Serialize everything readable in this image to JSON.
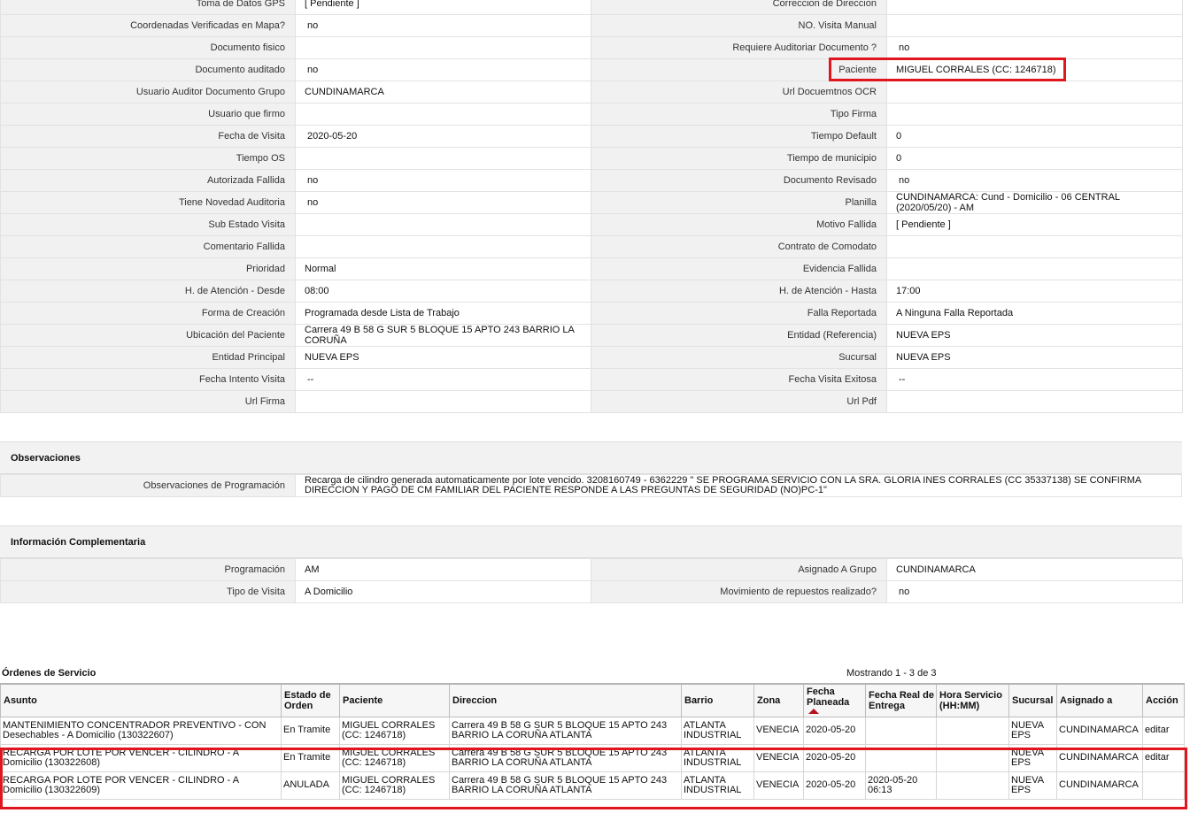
{
  "fields": [
    [
      "Toma de Datos GPS",
      "[ Pendiente ]",
      "Correccion de Direccion",
      ""
    ],
    [
      "Coordenadas Verificadas en Mapa?",
      "no",
      "NO. Visita Manual",
      ""
    ],
    [
      "Documento fisico",
      "",
      "Requiere Auditoriar Documento ?",
      "no"
    ],
    [
      "Documento auditado",
      "no",
      "Paciente",
      "MIGUEL CORRALES (CC: 1246718)"
    ],
    [
      "Usuario Auditor Documento Grupo",
      "CUNDINAMARCA",
      "Url Docuemtnos OCR",
      ""
    ],
    [
      "Usuario que firmo",
      "",
      "Tipo Firma",
      ""
    ],
    [
      "Fecha de Visita",
      "2020-05-20",
      "Tiempo Default",
      "0"
    ],
    [
      "Tiempo OS",
      "",
      "Tiempo de municipio",
      "0"
    ],
    [
      "Autorizada Fallida",
      "no",
      "Documento Revisado",
      "no"
    ],
    [
      "Tiene Novedad Auditoria",
      "no",
      "Planilla",
      "CUNDINAMARCA: Cund - Domicilio - 06 CENTRAL (2020/05/20) - AM"
    ],
    [
      "Sub Estado Visita",
      "",
      "Motivo Fallida",
      "[ Pendiente ]"
    ],
    [
      "Comentario Fallida",
      "",
      "Contrato de Comodato",
      ""
    ],
    [
      "Prioridad",
      "Normal",
      "Evidencia Fallida",
      ""
    ],
    [
      "H. de Atención - Desde",
      "08:00",
      "H. de Atención - Hasta",
      "17:00"
    ],
    [
      "Forma de Creación",
      "Programada desde Lista de Trabajo",
      "Falla Reportada",
      "A Ninguna Falla Reportada"
    ],
    [
      "Ubicación del Paciente",
      "Carrera 49 B 58 G SUR 5 BLOQUE 15 APTO 243 BARRIO LA CORUÑA",
      "Entidad (Referencia)",
      "NUEVA EPS"
    ],
    [
      "Entidad Principal",
      "NUEVA EPS",
      "Sucursal",
      "NUEVA EPS"
    ],
    [
      "Fecha Intento Visita",
      "--",
      "Fecha Visita Exitosa",
      "--"
    ],
    [
      "Url Firma",
      "",
      "Url Pdf",
      ""
    ]
  ],
  "observaciones": {
    "title": "Observaciones",
    "label": "Observaciones de Programación",
    "value": "Recarga de cilindro generada automaticamente por lote vencido. 3208160749 - 6362229 \" SE PROGRAMA SERVICIO CON LA SRA. GLORIA INES CORRALES (CC 35337138) SE CONFIRMA DIRECCION Y PAGO DE CM FAMILIAR DEL PACIENTE RESPONDE A LAS PREGUNTAS DE SEGURIDAD (NO)PC-1\""
  },
  "complementaria": {
    "title": "Información Complementaria",
    "rows": [
      [
        "Programación",
        "AM",
        "Asignado A Grupo",
        "CUNDINAMARCA"
      ],
      [
        "Tipo de Visita",
        "A Domicilio",
        "Movimiento de repuestos realizado?",
        "no"
      ]
    ]
  },
  "orders": {
    "title": "Órdenes de Servicio",
    "count_text": "Mostrando 1 - 3 de 3",
    "headers": [
      "Asunto",
      "Estado de Orden",
      "Paciente",
      "Direccion",
      "Barrio",
      "Zona",
      "Fecha Planeada",
      "Fecha Real de Entrega",
      "Hora Servicio (HH:MM)",
      "Sucursal",
      "Asignado a",
      "Acción"
    ],
    "sorted_column": "Fecha Planeada",
    "rows": [
      [
        "MANTENIMIENTO CONCENTRADOR PREVENTIVO - CON Desechables - A Domicilio (130322607)",
        "En Tramite",
        "MIGUEL CORRALES (CC: 1246718)",
        "Carrera 49 B 58 G SUR 5 BLOQUE 15 APTO 243 BARRIO LA CORUÑA ATLANTA",
        "ATLANTA INDUSTRIAL",
        "VENECIA",
        "2020-05-20",
        "",
        "",
        "NUEVA EPS",
        "CUNDINAMARCA",
        "editar"
      ],
      [
        "RECARGA POR LOTE POR VENCER - CILINDRO - A Domicilio (130322608)",
        "En Tramite",
        "MIGUEL CORRALES (CC: 1246718)",
        "Carrera 49 B 58 G SUR 5 BLOQUE 15 APTO 243 BARRIO LA CORUÑA ATLANTA",
        "ATLANTA INDUSTRIAL",
        "VENECIA",
        "2020-05-20",
        "",
        "",
        "NUEVA EPS",
        "CUNDINAMARCA",
        "editar"
      ],
      [
        "RECARGA POR LOTE POR VENCER - CILINDRO - A Domicilio (130322609)",
        "ANULADA",
        "MIGUEL CORRALES (CC: 1246718)",
        "Carrera 49 B 58 G SUR 5 BLOQUE 15 APTO 243 BARRIO LA CORUÑA ATLANTA",
        "ATLANTA INDUSTRIAL",
        "VENECIA",
        "2020-05-20",
        "2020-05-20 06:13",
        "",
        "NUEVA EPS",
        "CUNDINAMARCA",
        ""
      ]
    ]
  },
  "colors": {
    "highlight": "#e0161e",
    "label_bg": "#f1f1f1",
    "sort_indicator": "#b5121b"
  }
}
